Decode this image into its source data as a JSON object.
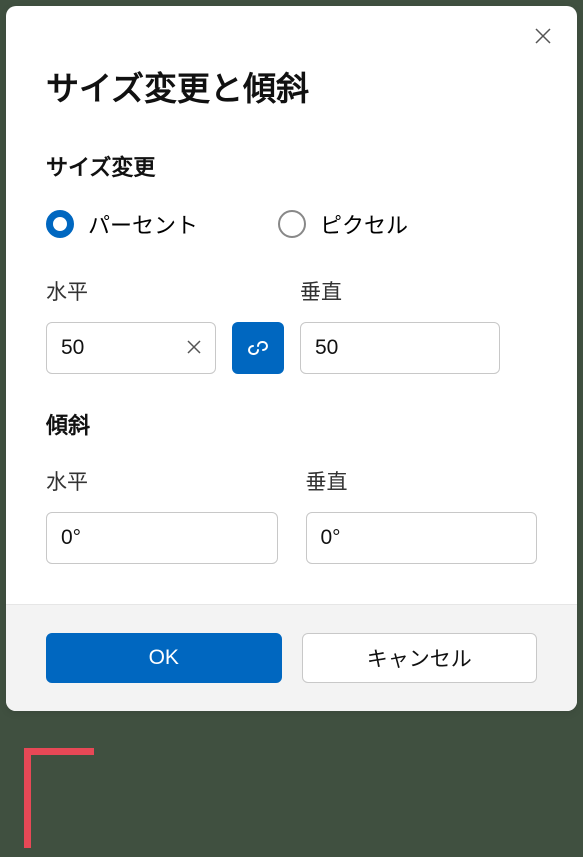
{
  "title": "サイズ変更と傾斜",
  "resize": {
    "section_label": "サイズ変更",
    "unit_percent": "パーセント",
    "unit_pixel": "ピクセル",
    "horizontal_label": "水平",
    "vertical_label": "垂直",
    "horizontal_value": "50",
    "vertical_value": "50"
  },
  "skew": {
    "section_label": "傾斜",
    "horizontal_label": "水平",
    "vertical_label": "垂直",
    "horizontal_value": "0°",
    "vertical_value": "0°"
  },
  "buttons": {
    "ok": "OK",
    "cancel": "キャンセル"
  }
}
